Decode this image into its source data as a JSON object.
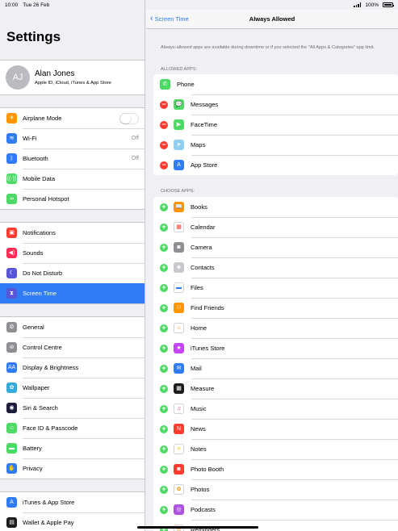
{
  "status": {
    "time": "10:00",
    "date": "Tue 26 Feb",
    "battery": "100%"
  },
  "sidebar": {
    "title": "Settings",
    "profile": {
      "initials": "AJ",
      "name": "Alan Jones",
      "subtitle": "Apple ID, iCloud, iTunes & App Store"
    },
    "group1": [
      {
        "label": "Airplane Mode",
        "icon": "airplane-icon",
        "color": "#ff9500",
        "glyph": "✈",
        "toggle": false
      },
      {
        "label": "Wi-Fi",
        "icon": "wifi-icon",
        "color": "#2f7cf6",
        "glyph": "≋",
        "value": "Off"
      },
      {
        "label": "Bluetooth",
        "icon": "bluetooth-icon",
        "color": "#2f7cf6",
        "glyph": "ᛒ",
        "value": "Off"
      },
      {
        "label": "Mobile Data",
        "icon": "antenna-icon",
        "color": "#4cd964",
        "glyph": "((·))"
      },
      {
        "label": "Personal Hotspot",
        "icon": "link-icon",
        "color": "#4cd964",
        "glyph": "∞"
      }
    ],
    "group2": [
      {
        "label": "Notifications",
        "icon": "notifications-icon",
        "color": "#ff3b30",
        "glyph": "▣"
      },
      {
        "label": "Sounds",
        "icon": "speaker-icon",
        "color": "#ff2d55",
        "glyph": "◀)"
      },
      {
        "label": "Do Not Disturb",
        "icon": "moon-icon",
        "color": "#5856d6",
        "glyph": "☾"
      },
      {
        "label": "Screen Time",
        "icon": "hourglass-icon",
        "color": "#5856d6",
        "glyph": "⧗",
        "selected": true
      }
    ],
    "group3": [
      {
        "label": "General",
        "icon": "gear-icon",
        "color": "#8e8e93",
        "glyph": "⚙"
      },
      {
        "label": "Control Centre",
        "icon": "switches-icon",
        "color": "#8e8e93",
        "glyph": "⊜"
      },
      {
        "label": "Display & Brightness",
        "icon": "text-size-icon",
        "color": "#2f7cf6",
        "glyph": "AA"
      },
      {
        "label": "Wallpaper",
        "icon": "flower-icon",
        "color": "#34aadc",
        "glyph": "✿"
      },
      {
        "label": "Siri & Search",
        "icon": "siri-icon",
        "color": "#1c1c3c",
        "glyph": "◉"
      },
      {
        "label": "Face ID & Passcode",
        "icon": "face-id-icon",
        "color": "#4cd964",
        "glyph": "☺"
      },
      {
        "label": "Battery",
        "icon": "battery-icon",
        "color": "#4cd964",
        "glyph": "▬"
      },
      {
        "label": "Privacy",
        "icon": "hand-icon",
        "color": "#2f7cf6",
        "glyph": "✋"
      }
    ],
    "group4": [
      {
        "label": "iTunes & App Store",
        "icon": "app-store-icon",
        "color": "#2f7cf6",
        "glyph": "A"
      },
      {
        "label": "Wallet & Apple Pay",
        "icon": "wallet-icon",
        "color": "#1c1c1e",
        "glyph": "▤"
      }
    ]
  },
  "detail": {
    "back_label": "Screen Time",
    "title": "Always Allowed",
    "description": "Always-allowed apps are available during downtime or if you selected the \"All Apps & Categories\" app limit.",
    "allowed_header": "ALLOWED APPS:",
    "phone": {
      "label": "Phone",
      "icon": "phone-icon",
      "color": "#4cd964",
      "glyph": "✆"
    },
    "allowed": [
      {
        "label": "Messages",
        "icon": "messages-icon",
        "color": "#4cd964",
        "glyph": "💬"
      },
      {
        "label": "FaceTime",
        "icon": "facetime-icon",
        "color": "#4cd964",
        "glyph": "▶"
      },
      {
        "label": "Maps",
        "icon": "maps-icon",
        "color": "#8fd0f0",
        "glyph": "➤"
      },
      {
        "label": "App Store",
        "icon": "app-store-icon",
        "color": "#2f7cf6",
        "glyph": "A"
      }
    ],
    "choose_header": "CHOOSE APPS:",
    "choose": [
      {
        "label": "Books",
        "icon": "books-icon",
        "color": "#ff9500",
        "glyph": "📖"
      },
      {
        "label": "Calendar",
        "icon": "calendar-icon",
        "color": "#ffffff",
        "glyph": "▦",
        "fg": "#ff3b30"
      },
      {
        "label": "Camera",
        "icon": "camera-icon",
        "color": "#8e8e93",
        "glyph": "◙"
      },
      {
        "label": "Contacts",
        "icon": "contacts-icon",
        "color": "#c7c7cc",
        "glyph": "☻"
      },
      {
        "label": "Files",
        "icon": "folder-icon",
        "color": "#ffffff",
        "glyph": "▬",
        "fg": "#2f7cf6"
      },
      {
        "label": "Find Friends",
        "icon": "find-friends-icon",
        "color": "#ff9500",
        "glyph": "⚇"
      },
      {
        "label": "Home",
        "icon": "home-icon",
        "color": "#ffffff",
        "glyph": "⌂",
        "fg": "#ff9500"
      },
      {
        "label": "iTunes Store",
        "icon": "itunes-store-icon",
        "color": "#c644fc",
        "glyph": "★"
      },
      {
        "label": "Mail",
        "icon": "mail-icon",
        "color": "#2f7cf6",
        "glyph": "✉"
      },
      {
        "label": "Measure",
        "icon": "measure-icon",
        "color": "#1c1c1e",
        "glyph": "▦"
      },
      {
        "label": "Music",
        "icon": "music-icon",
        "color": "#ffffff",
        "glyph": "♫",
        "fg": "#ff2d55"
      },
      {
        "label": "News",
        "icon": "news-icon",
        "color": "#ff3b30",
        "glyph": "N"
      },
      {
        "label": "Notes",
        "icon": "notes-icon",
        "color": "#ffffff",
        "glyph": "≡",
        "fg": "#ffcc00"
      },
      {
        "label": "Photo Booth",
        "icon": "photo-booth-icon",
        "color": "#ff3b30",
        "glyph": "◙"
      },
      {
        "label": "Photos",
        "icon": "photos-icon",
        "color": "#ffffff",
        "glyph": "✿",
        "fg": "#ff9500"
      },
      {
        "label": "Podcasts",
        "icon": "podcasts-icon",
        "color": "#af52de",
        "glyph": "◎"
      },
      {
        "label": "Reminders",
        "icon": "reminders-icon",
        "color": "#ffffff",
        "glyph": "☰",
        "fg": "#ff9500"
      }
    ]
  }
}
